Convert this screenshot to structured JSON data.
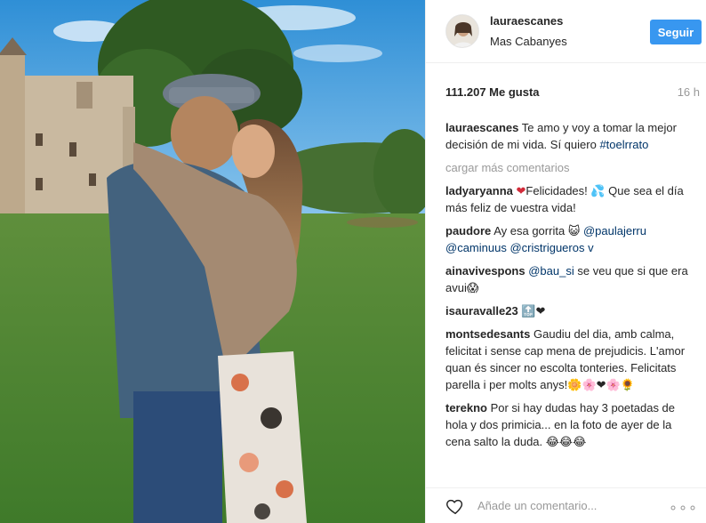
{
  "post": {
    "username": "lauraescanes",
    "location": "Mas Cabanyes",
    "follow_label": "Seguir",
    "likes": "111.207 Me gusta",
    "time_ago": "16 h",
    "load_more": "cargar más comentarios",
    "add_comment_placeholder": "Añade un comentario...",
    "more_options": "∘∘∘"
  },
  "caption": {
    "user": "lauraescanes",
    "text": "Te amo y voy a tomar la mejor decisión de mi vida. Sí quiero",
    "hashtag": "#toelrrato"
  },
  "comments": [
    {
      "user": "ladyaryanna",
      "heart": "❤",
      "text": "Felicidades! 💦 Que sea el día más feliz de vuestra vida!"
    },
    {
      "user": "paudore",
      "text": "Ay esa gorrita 😺",
      "mention1": "@paulajerru",
      "mention2": "@caminuus",
      "mention3": "@cristrigueros v"
    },
    {
      "user": "ainavivespons",
      "mention": "@bau_si",
      "text": "se veu que si que era avui😱"
    },
    {
      "user": "isauravalle23",
      "text": "🔝❤"
    },
    {
      "user": "montsedesants",
      "text": "Gaudiu del dia, amb calma, felicitat i sense cap mena de prejudicis. L'amor quan és sincer no escolta tonteries. Felicitats parella i per molts anys!🌼🌸❤🌸🌻"
    },
    {
      "user": "terekno",
      "text": "Por si hay dudas hay 3 poetadas de hola y dos primicia... en la foto de ayer de la cena salto la duda. 😂😂😂"
    }
  ],
  "icons": {
    "like": "heart-outline-icon",
    "more": "more-options-icon"
  },
  "colors": {
    "follow_button": "#3897f0",
    "mention": "#003569",
    "muted": "#999999"
  }
}
